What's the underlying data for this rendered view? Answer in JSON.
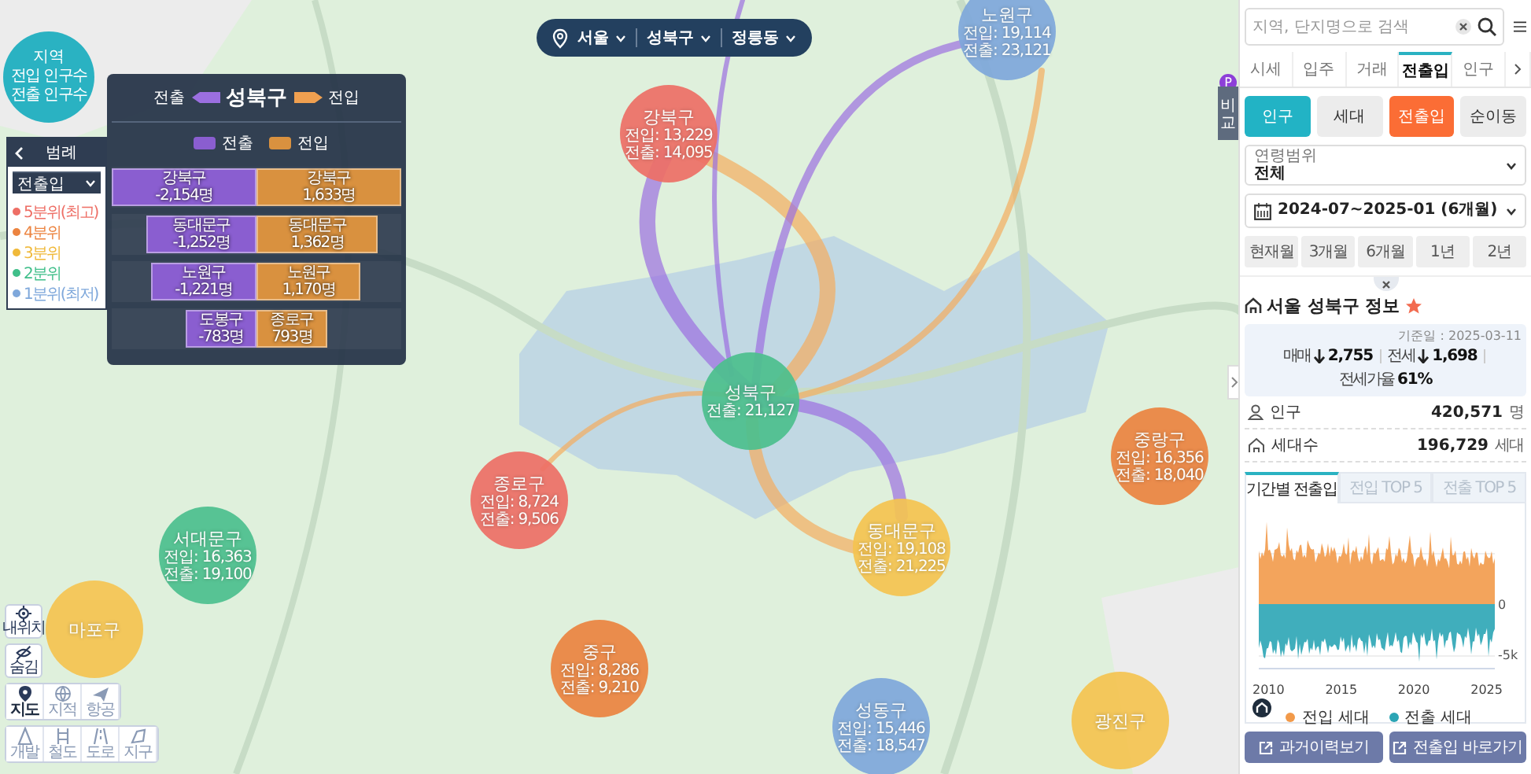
{
  "map": {
    "legend_bubble": {
      "title": "지역",
      "line_1": "전입 인구수",
      "line_2": "전출 인구수"
    },
    "location": [
      {
        "label": "서울"
      },
      {
        "label": "성북구"
      },
      {
        "label": "정릉동"
      }
    ],
    "compare_tab": {
      "badge": "P",
      "label": "비교"
    },
    "districts": [
      {
        "name": "노원구",
        "inflow": "전입: 19,114",
        "outflow": "전출: 23,121",
        "color": "#7fa8db"
      },
      {
        "name": "강북구",
        "inflow": "전입: 13,229",
        "outflow": "전출: 14,095",
        "color": "#ee6f66"
      },
      {
        "name": "성북구",
        "outflow": "전출: 21,127",
        "color": "#4cc08e"
      },
      {
        "name": "중랑구",
        "inflow": "전입: 16,356",
        "outflow": "전출: 18,040",
        "color": "#ec8440"
      },
      {
        "name": "종로구",
        "inflow": "전입: 8,724",
        "outflow": "전출: 9,506",
        "color": "#ee6f66"
      },
      {
        "name": "동대문구",
        "inflow": "전입: 19,108",
        "outflow": "전출: 21,225",
        "color": "#f5c451"
      },
      {
        "name": "서대문구",
        "inflow": "전입: 16,363",
        "outflow": "전출: 19,100",
        "color": "#4cc08e"
      },
      {
        "name": "마포구",
        "color": "#f5c451"
      },
      {
        "name": "중구",
        "inflow": "전입: 8,286",
        "outflow": "전출: 9,210",
        "color": "#ec8440"
      },
      {
        "name": "성동구",
        "inflow": "전입: 15,446",
        "outflow": "전출: 18,547",
        "color": "#7fa8db"
      },
      {
        "name": "광진구",
        "color": "#f5c451"
      }
    ],
    "legend_panel": {
      "title": "범례",
      "dropdown": "전출입",
      "items": [
        {
          "label": "5분위(최고)",
          "color": "#ee6f66"
        },
        {
          "label": "4분위",
          "color": "#ec8440"
        },
        {
          "label": "3분위",
          "color": "#f0b93a"
        },
        {
          "label": "2분위",
          "color": "#40bf8a"
        },
        {
          "label": "1분위(최저)",
          "color": "#7fa8db"
        }
      ]
    },
    "flow_panel": {
      "out_label": "전출",
      "district": "성북구",
      "in_label": "전입",
      "legend": [
        "전출",
        "전입"
      ],
      "rows": [
        {
          "out": {
            "name": "강북구",
            "value": "-2,154명",
            "level": 1
          },
          "in": {
            "name": "강북구",
            "value": "1,633명",
            "level": 1
          }
        },
        {
          "out": {
            "name": "동대문구",
            "value": "-1,252명",
            "level": 0.76
          },
          "in": {
            "name": "동대문구",
            "value": "1,362명",
            "level": 0.84
          }
        },
        {
          "out": {
            "name": "노원구",
            "value": "-1,221명",
            "level": 0.73
          },
          "in": {
            "name": "노원구",
            "value": "1,170명",
            "level": 0.72
          }
        },
        {
          "out": {
            "name": "도봉구",
            "value": "-783명",
            "level": 0.49
          },
          "in": {
            "name": "종로구",
            "value": "793명",
            "level": 0.49
          }
        }
      ]
    },
    "tools": [
      {
        "label": "내위치",
        "kind": "target"
      },
      {
        "label": "숨김",
        "kind": "hide"
      }
    ],
    "map_types": [
      {
        "label": "지도",
        "kind": "pin",
        "selected": true
      },
      {
        "label": "지적",
        "kind": "globe",
        "selected": false
      },
      {
        "label": "항공",
        "kind": "plane",
        "selected": false
      }
    ],
    "layers": [
      {
        "label": "개발",
        "kind": "cone"
      },
      {
        "label": "철도",
        "kind": "rail"
      },
      {
        "label": "도로",
        "kind": "road"
      },
      {
        "label": "지구",
        "kind": "zone"
      }
    ]
  },
  "sidebar": {
    "search": {
      "placeholder": "지역, 단지명으로 검색"
    },
    "tabs": [
      {
        "label": "시세",
        "selected": false
      },
      {
        "label": "입주",
        "selected": false
      },
      {
        "label": "거래",
        "selected": false
      },
      {
        "label": "전출입",
        "selected": true
      },
      {
        "label": "인구",
        "selected": false
      }
    ],
    "subject_buttons": [
      {
        "label": "인구",
        "selected": true
      },
      {
        "label": "세대",
        "selected": false
      }
    ],
    "mode_buttons": [
      {
        "label": "전출입",
        "selected": true
      },
      {
        "label": "순이동",
        "selected": false
      }
    ],
    "age_range": {
      "label": "연령범위",
      "value": "전체"
    },
    "period": "2024-07~2025-01 (6개월)",
    "period_buttons": [
      {
        "label": "현재월"
      },
      {
        "label": "3개월"
      },
      {
        "label": "6개월"
      },
      {
        "label": "1년"
      },
      {
        "label": "2년"
      }
    ],
    "info": {
      "title": "서울 성북구 정보",
      "favorite": true,
      "date": "기준일 : 2025-03-11",
      "stats": [
        {
          "label": "매매",
          "value": "2,755"
        },
        {
          "label": "전세",
          "value": "1,698"
        },
        {
          "label": "전세가율",
          "value": "61%"
        }
      ],
      "population": {
        "label": "인구",
        "value": "420,571",
        "unit": "명"
      },
      "households": {
        "label": "세대수",
        "value": "196,729",
        "unit": "세대"
      }
    },
    "chart_tabs": [
      {
        "label": "기간별 전출입",
        "selected": true
      },
      {
        "label": "전입 TOP 5",
        "selected": false
      },
      {
        "label": "전출 TOP 5",
        "selected": false
      }
    ],
    "chart": {
      "y_labels": [
        "0",
        "-5k"
      ],
      "x_labels": [
        "2010",
        "2015",
        "2020",
        "2025"
      ],
      "legend": [
        {
          "label": "전입 세대",
          "color": "#f29a4a"
        },
        {
          "label": "전출 세대",
          "color": "#2ba5b5"
        }
      ]
    },
    "buttons": [
      {
        "label": "과거이력보기"
      },
      {
        "label": "전출입 바로가기"
      }
    ]
  }
}
